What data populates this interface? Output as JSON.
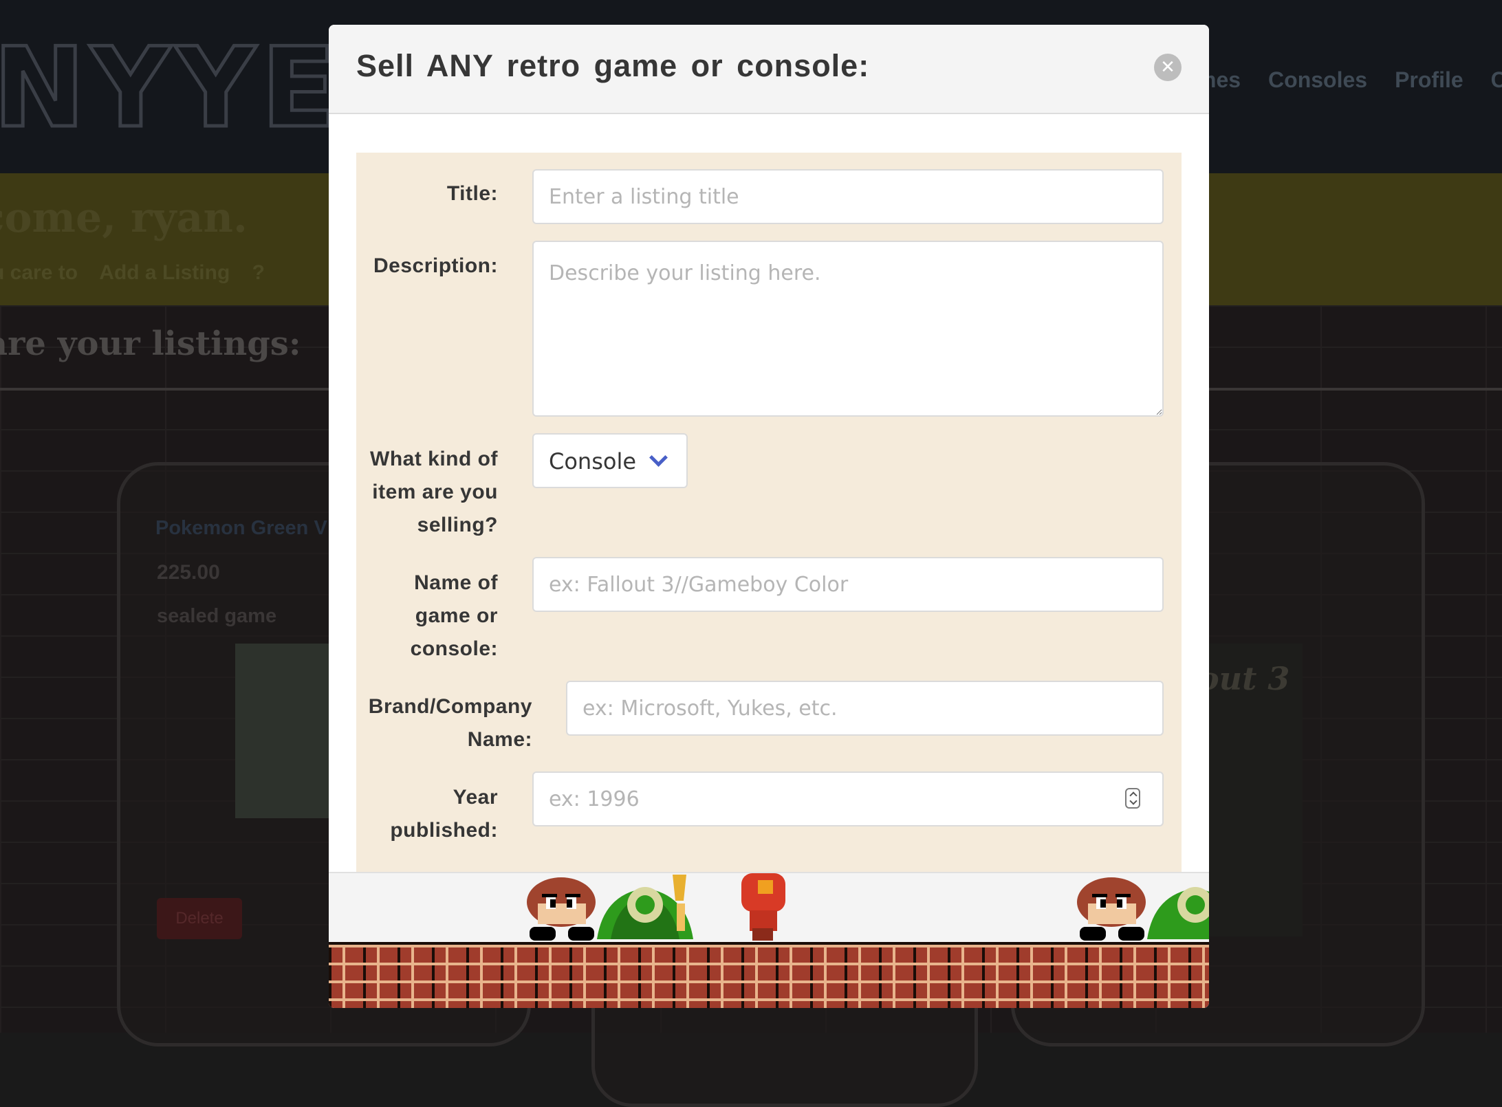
{
  "background": {
    "logo_text": "NYYES",
    "nav_links": [
      "mes",
      "Consoles",
      "Profile",
      "Car"
    ],
    "welcome": "come, ryan.",
    "care_prefix": "u care to",
    "care_link": "Add a Listing",
    "care_suffix": "?",
    "listings_heading": "are your listings:",
    "card": {
      "title": "Pokemon Green V",
      "price": "225.00",
      "description": "sealed game",
      "delete_label": "Delete"
    },
    "fallout_cover_text": "out 3"
  },
  "modal": {
    "title": "Sell ANY retro game or console:",
    "close_icon": "close-icon",
    "form": {
      "title_label": "Title:",
      "title_placeholder": "Enter a listing title",
      "description_label": "Description:",
      "description_placeholder": "Describe your listing here.",
      "kind_label": "What kind of item are you selling?",
      "kind_value": "Console",
      "name_label": "Name of game or console:",
      "name_placeholder": "ex: Fallout 3//Gameboy Color",
      "brand_label": "Brand/Company Name:",
      "brand_placeholder": "ex: Microsoft, Yukes, etc.",
      "year_label": "Year published:",
      "year_placeholder": "ex: 1996"
    }
  },
  "colors": {
    "accent": "#485fc7",
    "form_bg": "#f5ebdb",
    "brick": "#a03c2c"
  }
}
